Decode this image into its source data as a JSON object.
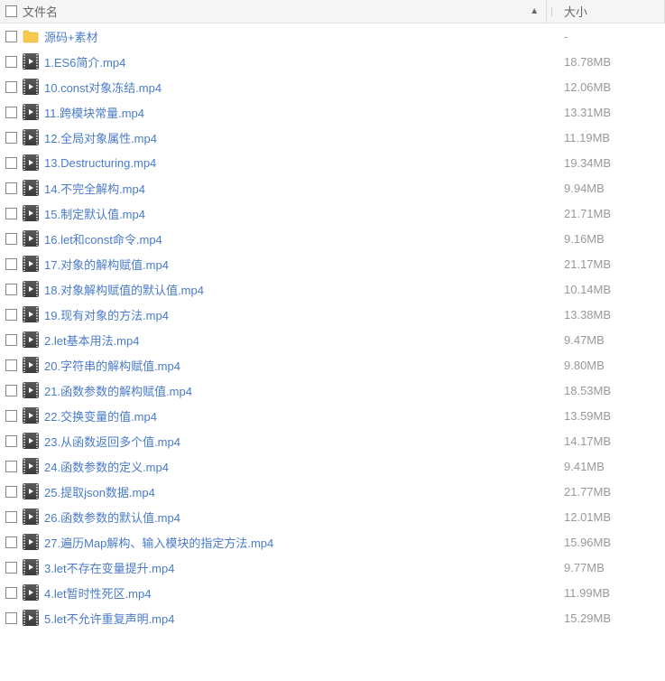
{
  "header": {
    "name_label": "文件名",
    "size_label": "大小",
    "sort_indicator": "▲"
  },
  "files": [
    {
      "type": "folder",
      "name": "源码+素材",
      "size": "-"
    },
    {
      "type": "video",
      "name": "1.ES6简介.mp4",
      "size": "18.78MB"
    },
    {
      "type": "video",
      "name": "10.const对象冻结.mp4",
      "size": "12.06MB"
    },
    {
      "type": "video",
      "name": "11.跨模块常量.mp4",
      "size": "13.31MB"
    },
    {
      "type": "video",
      "name": "12.全局对象属性.mp4",
      "size": "11.19MB"
    },
    {
      "type": "video",
      "name": "13.Destructuring.mp4",
      "size": "19.34MB"
    },
    {
      "type": "video",
      "name": "14.不完全解构.mp4",
      "size": "9.94MB"
    },
    {
      "type": "video",
      "name": "15.制定默认值.mp4",
      "size": "21.71MB"
    },
    {
      "type": "video",
      "name": "16.let和const命令.mp4",
      "size": "9.16MB"
    },
    {
      "type": "video",
      "name": "17.对象的解构赋值.mp4",
      "size": "21.17MB"
    },
    {
      "type": "video",
      "name": "18.对象解构赋值的默认值.mp4",
      "size": "10.14MB"
    },
    {
      "type": "video",
      "name": "19.现有对象的方法.mp4",
      "size": "13.38MB"
    },
    {
      "type": "video",
      "name": "2.let基本用法.mp4",
      "size": "9.47MB"
    },
    {
      "type": "video",
      "name": "20.字符串的解构赋值.mp4",
      "size": "9.80MB"
    },
    {
      "type": "video",
      "name": "21.函数参数的解构赋值.mp4",
      "size": "18.53MB"
    },
    {
      "type": "video",
      "name": "22.交换变量的值.mp4",
      "size": "13.59MB"
    },
    {
      "type": "video",
      "name": "23.从函数返回多个值.mp4",
      "size": "14.17MB"
    },
    {
      "type": "video",
      "name": "24.函数参数的定义.mp4",
      "size": "9.41MB"
    },
    {
      "type": "video",
      "name": "25.提取json数据.mp4",
      "size": "21.77MB"
    },
    {
      "type": "video",
      "name": "26.函数参数的默认值.mp4",
      "size": "12.01MB"
    },
    {
      "type": "video",
      "name": "27.遍历Map解构、输入模块的指定方法.mp4",
      "size": "15.96MB"
    },
    {
      "type": "video",
      "name": "3.let不存在变量提升.mp4",
      "size": "9.77MB"
    },
    {
      "type": "video",
      "name": "4.let暂时性死区.mp4",
      "size": "11.99MB"
    },
    {
      "type": "video",
      "name": "5.let不允许重复声明.mp4",
      "size": "15.29MB"
    }
  ]
}
